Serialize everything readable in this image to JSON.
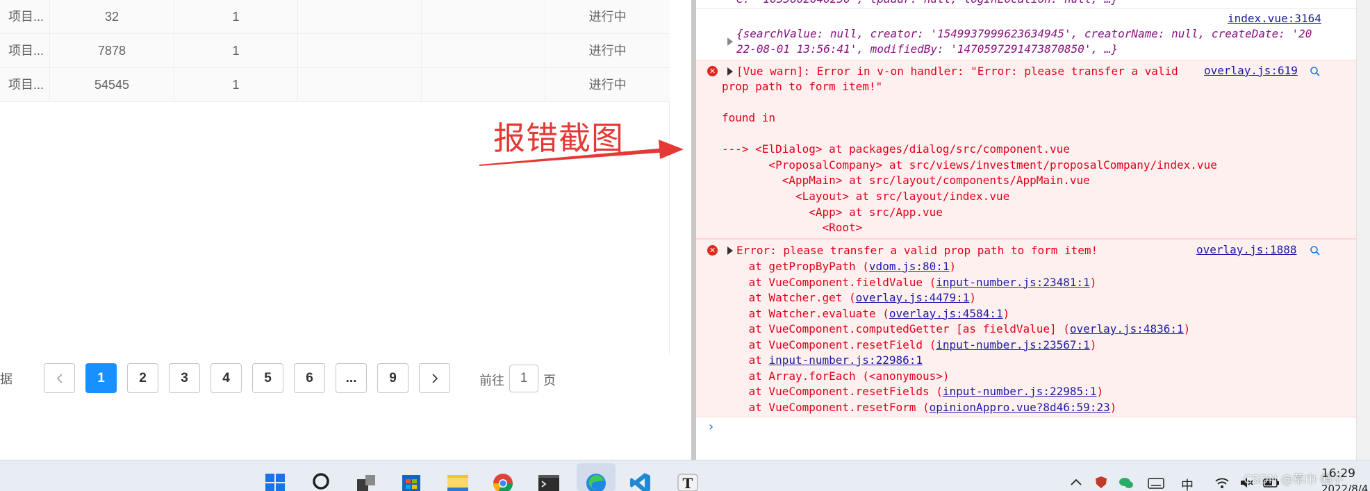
{
  "table": {
    "rows": [
      {
        "name": "项目...",
        "c1": "32",
        "c2": "1",
        "c3": "",
        "c4": "",
        "status": "进行中"
      },
      {
        "name": "项目...",
        "c1": "7878",
        "c2": "1",
        "c3": "",
        "c4": "",
        "status": "进行中"
      },
      {
        "name": "项目...",
        "c1": "54545",
        "c2": "1",
        "c3": "",
        "c4": "",
        "status": "进行中"
      }
    ]
  },
  "annotation": {
    "text": "报错截图",
    "color": "#e53935"
  },
  "pagination": {
    "total_suffix": "据",
    "prev": "<",
    "next": ">",
    "pages": [
      "1",
      "2",
      "3",
      "4",
      "5",
      "6",
      "...",
      "9"
    ],
    "current_page": "1",
    "goto_label": "前往",
    "goto_value": "1",
    "goto_suffix": "页",
    "accent": "#1890ff"
  },
  "console": {
    "top_clipped": "e: '1655602640250', tpaddr: null, logInLocation: null, …}",
    "log": {
      "source": "index.vue:3164",
      "line1": "{searchValue: null, creator: '1549937999623634945', creatorName: null, createDate: '20",
      "line2": "22-08-01 13:56:41', modifiedBy: '1470597291473870850', …}"
    },
    "warn": {
      "source": "overlay.js:619",
      "line1": "[Vue warn]: Error in v-on handler: \"Error: please transfer a valid",
      "line2": "prop path to form item!\"",
      "found_in": "found in",
      "tree": [
        "---> <ElDialog> at packages/dialog/src/component.vue",
        "       <ProposalCompany> at src/views/investment/proposalCompany/index.vue",
        "         <AppMain> at src/layout/components/AppMain.vue",
        "           <Layout> at src/layout/index.vue",
        "             <App> at src/App.vue",
        "               <Root>"
      ]
    },
    "error": {
      "source": "overlay.js:1888",
      "title": "Error: please transfer a valid prop path to form item!",
      "stack": [
        {
          "pre": "    at getPropByPath (",
          "link": "vdom.js:80:1",
          "post": ")"
        },
        {
          "pre": "    at VueComponent.fieldValue (",
          "link": "input-number.js:23481:1",
          "post": ")"
        },
        {
          "pre": "    at Watcher.get (",
          "link": "overlay.js:4479:1",
          "post": ")"
        },
        {
          "pre": "    at Watcher.evaluate (",
          "link": "overlay.js:4584:1",
          "post": ")"
        },
        {
          "pre": "    at VueComponent.computedGetter [as fieldValue] (",
          "link": "overlay.js:4836:1",
          "post": ")"
        },
        {
          "pre": "    at VueComponent.resetField (",
          "link": "input-number.js:23567:1",
          "post": ")"
        },
        {
          "pre": "    at ",
          "link": "input-number.js:22986:1",
          "post": ""
        },
        {
          "pre": "    at Array.forEach (<anonymous>)",
          "link": "",
          "post": ""
        },
        {
          "pre": "    at VueComponent.resetFields (",
          "link": "input-number.js:22985:1",
          "post": ")"
        },
        {
          "pre": "    at VueComponent.resetForm (",
          "link": "opinionAppro.vue?8d46:59:23",
          "post": ")"
        }
      ]
    },
    "prompt": "›"
  },
  "taskbar": {
    "icons": [
      "windows-start-icon",
      "search-icon",
      "task-view-icon",
      "store-icon",
      "file-explorer-icon",
      "chrome-icon",
      "terminal-icon",
      "edge-icon",
      "vscode-icon",
      "typora-icon"
    ],
    "tray_ime": "中",
    "clock_time": "16:29",
    "clock_date": "2022/8/4",
    "watermark": "CSDN @草巾 帽子"
  }
}
